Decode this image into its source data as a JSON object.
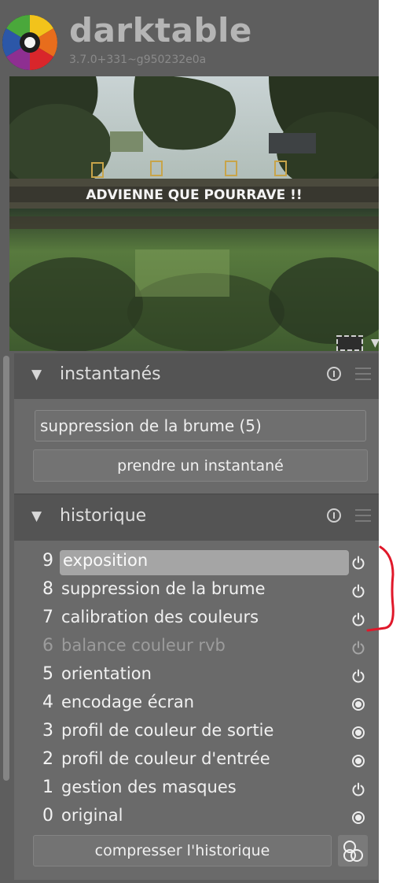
{
  "app": {
    "title": "darktable",
    "version": "3.7.0+331~g950232e0a"
  },
  "preview": {
    "graffiti_text": "ADVIENNE QUE POURRAVE !!"
  },
  "snapshots": {
    "title": "instantanés",
    "current": "suppression de la brume (5)",
    "take_button": "prendre un instantané"
  },
  "history": {
    "title": "historique",
    "items": [
      {
        "num": "9",
        "label": "exposition",
        "icon": "power-icon",
        "selected": true,
        "dim": false
      },
      {
        "num": "8",
        "label": "suppression de la brume",
        "icon": "power-icon",
        "selected": false,
        "dim": false
      },
      {
        "num": "7",
        "label": "calibration des couleurs",
        "icon": "power-icon",
        "selected": false,
        "dim": false
      },
      {
        "num": "6",
        "label": "balance couleur rvb",
        "icon": "power-icon",
        "selected": false,
        "dim": true
      },
      {
        "num": "5",
        "label": "orientation",
        "icon": "power-icon",
        "selected": false,
        "dim": false
      },
      {
        "num": "4",
        "label": "encodage écran",
        "icon": "always-on-icon",
        "selected": false,
        "dim": false
      },
      {
        "num": "3",
        "label": "profil de couleur de sortie",
        "icon": "always-on-icon",
        "selected": false,
        "dim": false
      },
      {
        "num": "2",
        "label": "profil de couleur d'entrée",
        "icon": "always-on-icon",
        "selected": false,
        "dim": false
      },
      {
        "num": "1",
        "label": "gestion des masques",
        "icon": "power-icon",
        "selected": false,
        "dim": false
      },
      {
        "num": "0",
        "label": "original",
        "icon": "always-on-icon",
        "selected": false,
        "dim": false
      }
    ],
    "compress_button": "compresser l'historique"
  },
  "colors": {
    "panel": "#5e5e5e",
    "selected": "#a5a5a5",
    "annotation": "#e0182a"
  }
}
